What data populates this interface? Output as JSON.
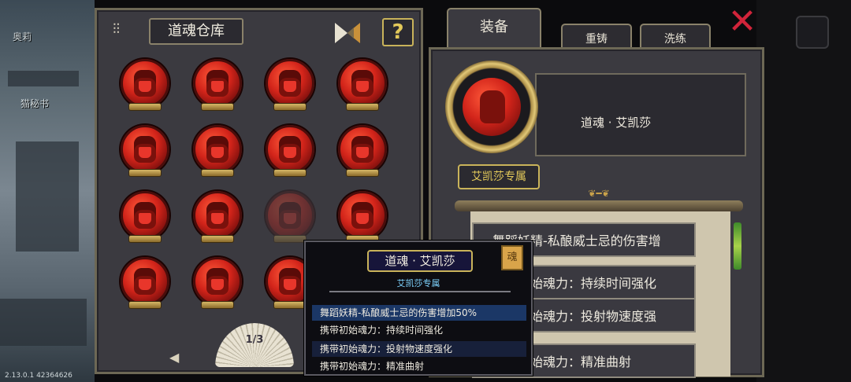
{
  "world": {
    "label_top": "奥莉",
    "label_mid": "猫秘书",
    "version": "2.13.0.1 42364626"
  },
  "left_panel": {
    "title": "道魂仓库",
    "help_label": "?",
    "page": "1/3",
    "prev_arrow": "◀",
    "slots": [
      {
        "state": "normal"
      },
      {
        "state": "normal"
      },
      {
        "state": "normal"
      },
      {
        "state": "normal"
      },
      {
        "state": "normal"
      },
      {
        "state": "normal"
      },
      {
        "state": "normal"
      },
      {
        "state": "normal"
      },
      {
        "state": "normal"
      },
      {
        "state": "normal"
      },
      {
        "state": "dimmed"
      },
      {
        "state": "normal"
      },
      {
        "state": "normal"
      },
      {
        "state": "normal"
      },
      {
        "state": "normal"
      },
      {
        "state": "normal"
      }
    ]
  },
  "tabs": {
    "equip": "装备",
    "recast": "重铸",
    "refine": "洗练"
  },
  "detail": {
    "soul_name": "道魂 · 艾凯莎",
    "exclusive": "艾凯莎专属",
    "effects": [
      "舞蹈妖精-私酿威士忌的伤害增",
      "携带初始魂力：持续时间强化",
      "携带初始魂力：投射物速度强",
      "携带初始魂力：精准曲射"
    ]
  },
  "tooltip": {
    "title": "道魂 · 艾凯莎",
    "subtitle": "艾凯莎专属",
    "icon_glyph": "魂",
    "lines": [
      "舞蹈妖精-私酿威士忌的伤害增加50%",
      "携带初始魂力：持续时间强化",
      "携带初始魂力：投射物速度强化",
      "携带初始魂力：精准曲射"
    ]
  },
  "colors": {
    "panel": "#3b3a40",
    "gold": "#c9b35a",
    "orb_red": "#d2241a",
    "close_red": "#d1243a",
    "tooltip_highlight": "#1b3766"
  }
}
